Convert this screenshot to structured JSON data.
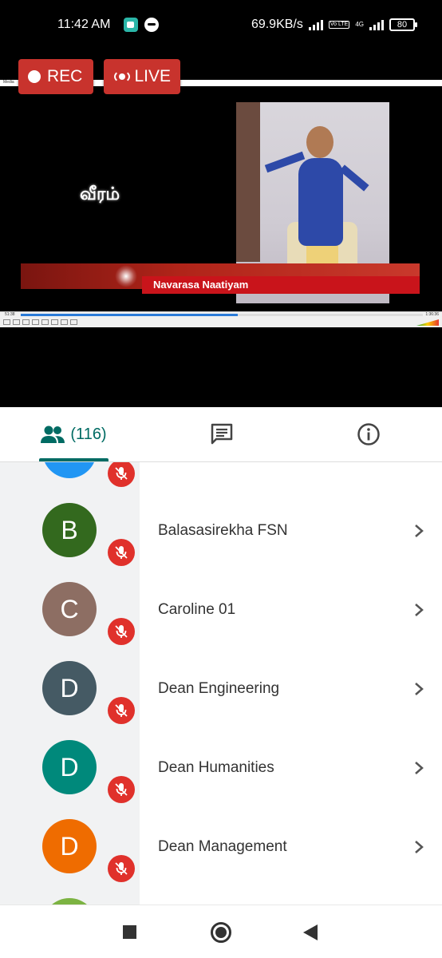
{
  "status_bar": {
    "time": "11:42 AM",
    "network_speed": "69.9KB/s",
    "volte": "Vo LTE",
    "network_type": "4G",
    "battery": "80"
  },
  "stream": {
    "rec_label": "REC",
    "live_label": "LIVE",
    "media_menu": "Media",
    "title_tamil": "வீரம்",
    "banner_text": "Navarasa Naatiyam",
    "time_elapsed": "51:38",
    "time_total": "1:36:36",
    "volume_label": "122%",
    "progress": 0.54
  },
  "tabs": {
    "people_count": "(116)",
    "people_icon": "people-icon",
    "chat_icon": "chat-icon",
    "info_icon": "info-icon",
    "accent_color": "#006b63"
  },
  "participants": [
    {
      "initial": "",
      "name": "",
      "color": "#2196f3"
    },
    {
      "initial": "B",
      "name": "Balasasirekha FSN",
      "color": "#33691e"
    },
    {
      "initial": "C",
      "name": "Caroline 01",
      "color": "#8d6e63"
    },
    {
      "initial": "D",
      "name": "Dean Engineering",
      "color": "#455a64"
    },
    {
      "initial": "D",
      "name": "Dean Humanities",
      "color": "#00897b"
    },
    {
      "initial": "D",
      "name": "Dean Management",
      "color": "#ef6c00"
    },
    {
      "initial": "",
      "name": "",
      "color": "#7cb342"
    }
  ],
  "colors": {
    "mic_muted": "#e0312b",
    "rec_button": "#c8332d"
  }
}
